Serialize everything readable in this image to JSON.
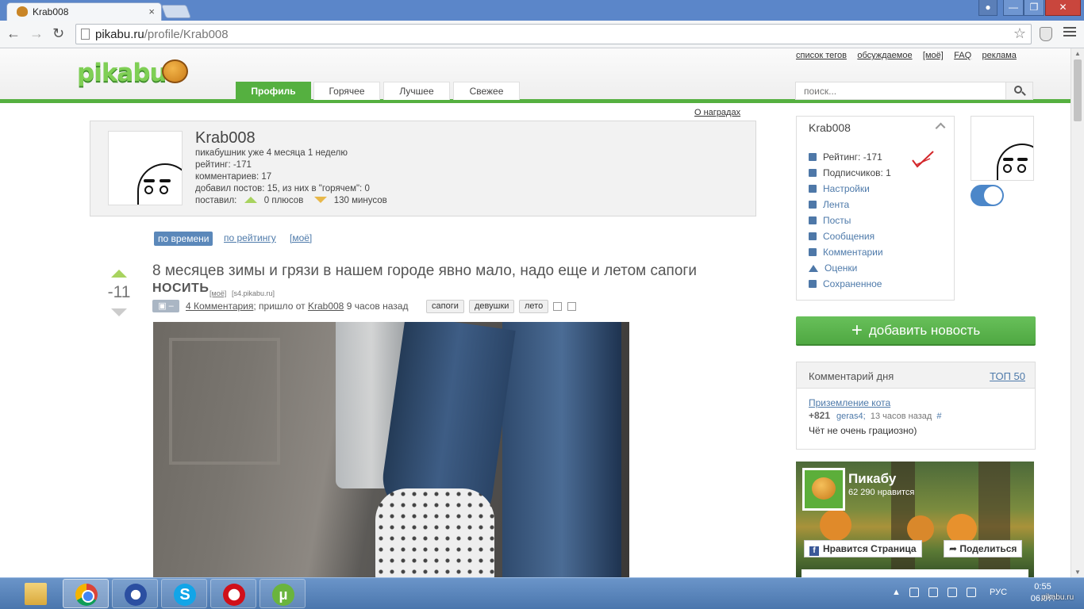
{
  "browser": {
    "tab_title": "Krab008",
    "tab_close": "×",
    "url_host": "pikabu.ru",
    "url_path": "/profile/Krab008",
    "window_controls": {
      "minimize": "—",
      "maximize": "❐",
      "close": "✕"
    },
    "nav": {
      "back": "←",
      "forward": "→",
      "reload": "↻"
    },
    "star": "☆"
  },
  "site": {
    "logo": "pikabu",
    "top_links": [
      "список тегов",
      "обсуждаемое",
      "[моё]",
      "FAQ",
      "реклама"
    ],
    "tabs": [
      "Профиль",
      "Горячее",
      "Лучшее",
      "Свежее"
    ],
    "active_tab": "Профиль",
    "search_placeholder": "поиск...",
    "awards_link": "О наградах",
    "accent_color": "#55b040"
  },
  "profile": {
    "name": "Krab008",
    "since": "пикабушник уже 4 месяца 1 неделю",
    "rating": "рейтинг: -171",
    "comments": "комментариев: 17",
    "posts": "добавил постов: 15, из них в \"горячем\": 0",
    "votes_label": "поставил:",
    "plus": "0 плюсов",
    "minus": "130 минусов"
  },
  "sort": {
    "active": "по времени",
    "by_rating": "по рейтингу",
    "mine": "[моё]"
  },
  "story": {
    "rating": "-11",
    "title": "8 месяцев зимы и грязи в нашем городе явно мало, надо еще и летом сапоги",
    "title_tail": "НОСИТЬ",
    "mine": "[моё]",
    "source": "[s4.pikabu.ru]",
    "camera": "–",
    "comments_link": "4 Комментария",
    "from_text": "; пришло от",
    "author": "Krab008",
    "time": "9 часов назад",
    "tags": [
      "сапоги",
      "девушки",
      "лето"
    ]
  },
  "sidebar": {
    "username": "Krab008",
    "items": [
      {
        "label": "Рейтинг: -171",
        "icon": "chart-icon"
      },
      {
        "label": "Подписчиков: 1",
        "icon": "user-icon"
      },
      {
        "label": "Настройки",
        "icon": "gear-icon"
      },
      {
        "label": "Лента",
        "icon": "feed-icon"
      },
      {
        "label": "Посты",
        "icon": "posts-icon"
      },
      {
        "label": "Сообщения",
        "icon": "mail-icon"
      },
      {
        "label": "Комментарии",
        "icon": "comments-icon"
      },
      {
        "label": "Оценки",
        "icon": "votes-icon"
      },
      {
        "label": "Сохраненное",
        "icon": "save-icon"
      }
    ],
    "add_news": "добавить новость",
    "add_plus": "+",
    "comment_of_day": {
      "title": "Комментарий дня",
      "top_link": "ТОП 50",
      "post_link": "Приземление кота",
      "score": "+821",
      "user": "geras4;",
      "time": "13 часов назад",
      "hash": "#",
      "text": "Чёт не очень грациозно)"
    },
    "facebook": {
      "page_name": "Пикабу",
      "likes": "62 290 нравится",
      "like_button": "Нравится Страница",
      "share_button": "Поделиться",
      "fb_glyph": "f",
      "share_glyph": "➦"
    }
  },
  "taskbar": {
    "apps": [
      "folder-icon",
      "chrome-icon",
      "alarm-icon",
      "skype-icon",
      "opera-icon",
      "utorrent-icon"
    ],
    "skype_glyph": "S",
    "torrent_glyph": "μ",
    "language": "РУС",
    "time": "0:55",
    "date": "06.07.",
    "watermark": "pikabu.ru"
  }
}
